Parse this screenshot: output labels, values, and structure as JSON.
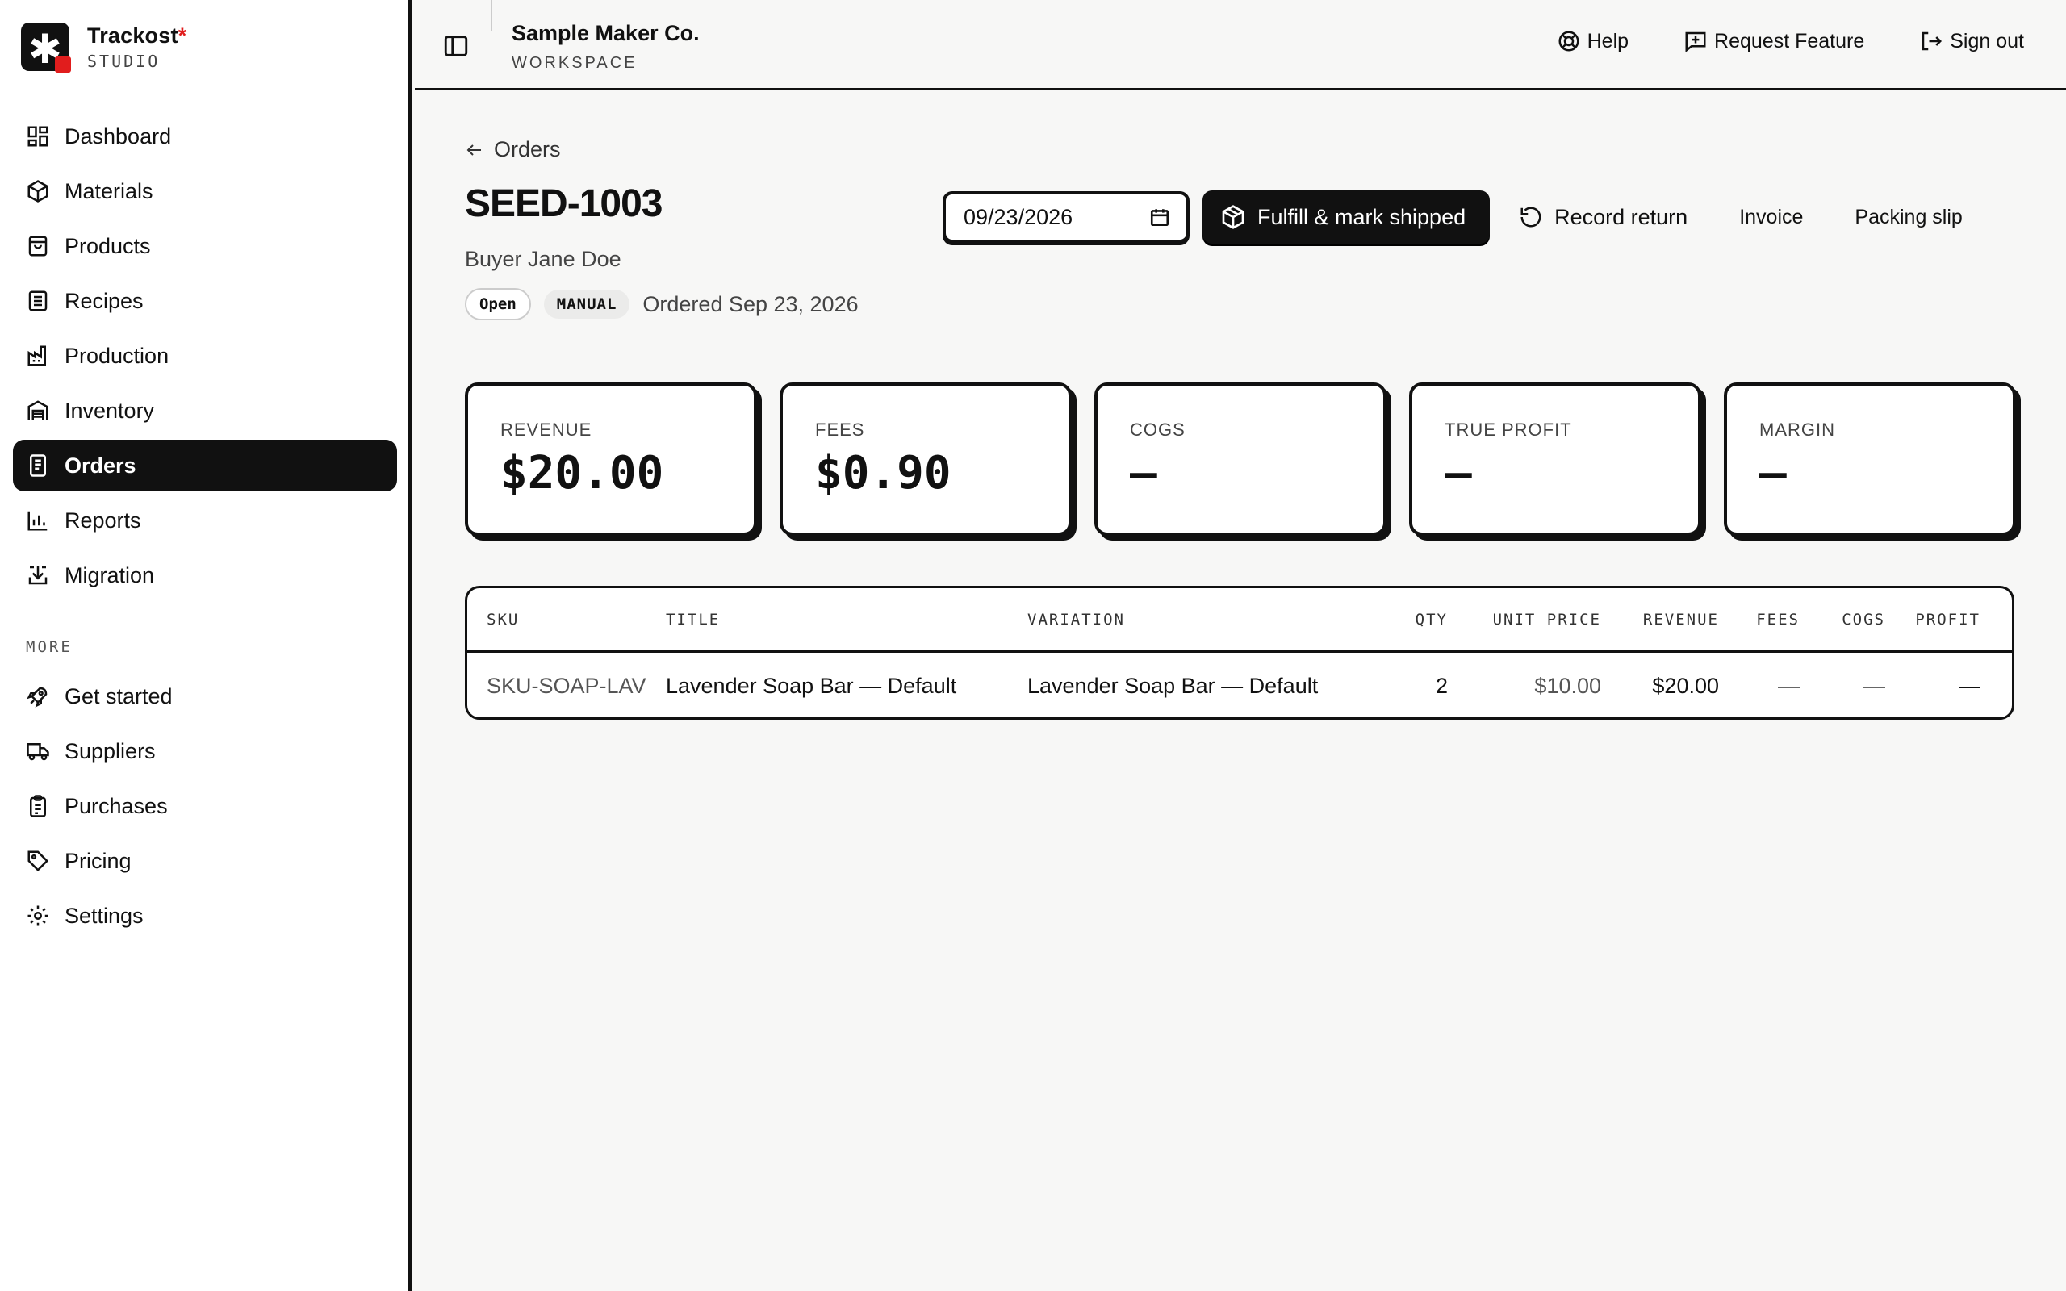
{
  "brand": {
    "name": "Trackost",
    "mark": "*",
    "sub": "STUDIO"
  },
  "nav": {
    "items": [
      {
        "label": "Dashboard",
        "icon": "dashboard-icon"
      },
      {
        "label": "Materials",
        "icon": "box-icon"
      },
      {
        "label": "Products",
        "icon": "bag-icon"
      },
      {
        "label": "Recipes",
        "icon": "list-icon"
      },
      {
        "label": "Production",
        "icon": "factory-icon"
      },
      {
        "label": "Inventory",
        "icon": "warehouse-icon"
      },
      {
        "label": "Orders",
        "icon": "receipt-icon",
        "active": true
      },
      {
        "label": "Reports",
        "icon": "bar-chart-icon"
      },
      {
        "label": "Migration",
        "icon": "import-icon"
      }
    ],
    "more_label": "MORE",
    "more_items": [
      {
        "label": "Get started",
        "icon": "rocket-icon"
      },
      {
        "label": "Suppliers",
        "icon": "truck-icon"
      },
      {
        "label": "Purchases",
        "icon": "clipboard-icon"
      },
      {
        "label": "Pricing",
        "icon": "tag-icon"
      },
      {
        "label": "Settings",
        "icon": "gear-icon"
      }
    ]
  },
  "topbar": {
    "workspace_name": "Sample Maker Co.",
    "workspace_sub": "WORKSPACE",
    "help": "Help",
    "request_feature": "Request Feature",
    "sign_out": "Sign out"
  },
  "order": {
    "back_label": "Orders",
    "id": "SEED-1003",
    "buyer": "Buyer Jane Doe",
    "status": "Open",
    "source": "MANUAL",
    "ordered": "Ordered Sep 23, 2026",
    "date_value": "09/23/2026",
    "fulfill_label": "Fulfill & mark shipped",
    "return_label": "Record return",
    "invoice_label": "Invoice",
    "packing_label": "Packing slip"
  },
  "kpis": [
    {
      "label": "REVENUE",
      "value": "$20.00"
    },
    {
      "label": "FEES",
      "value": "$0.90"
    },
    {
      "label": "COGS",
      "value": "—"
    },
    {
      "label": "TRUE PROFIT",
      "value": "—"
    },
    {
      "label": "MARGIN",
      "value": "—"
    }
  ],
  "table": {
    "headers": {
      "sku": "SKU",
      "title": "TITLE",
      "variation": "VARIATION",
      "qty": "QTY",
      "unit_price": "UNIT PRICE",
      "revenue": "REVENUE",
      "fees": "FEES",
      "cogs": "COGS",
      "profit": "PROFIT"
    },
    "rows": [
      {
        "sku": "SKU-SOAP-LAV",
        "title": "Lavender Soap Bar — Default",
        "variation": "Lavender Soap Bar — Default",
        "qty": "2",
        "unit_price": "$10.00",
        "revenue": "$20.00",
        "fees": "—",
        "cogs": "—",
        "profit": "—"
      }
    ]
  }
}
